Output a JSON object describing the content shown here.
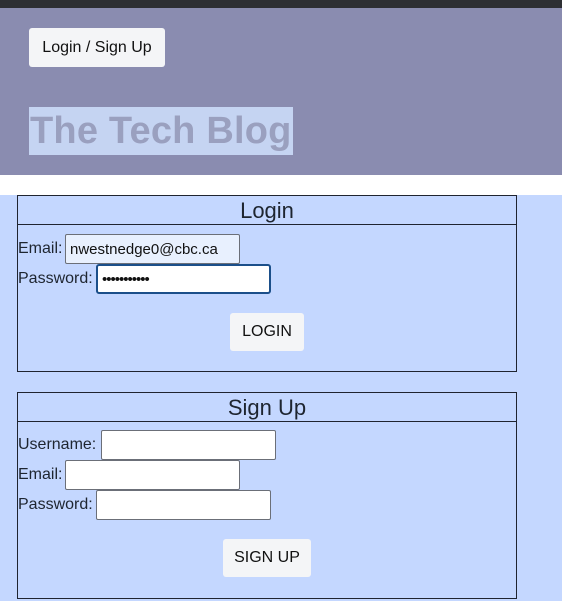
{
  "header": {
    "nav_button_label": "Login / Sign Up",
    "site_title": "The Tech Blog"
  },
  "login": {
    "title": "Login",
    "email_label": "Email:",
    "email_value": "nwestnedge0@cbc.ca",
    "password_label": "Password:",
    "password_value": "•••••••••••",
    "submit_label": "LOGIN"
  },
  "signup": {
    "title": "Sign Up",
    "username_label": "Username:",
    "username_value": "",
    "email_label": "Email:",
    "email_value": "",
    "password_label": "Password:",
    "password_value": "",
    "submit_label": "SIGN UP"
  },
  "colors": {
    "header_bg": "#8a8cb0",
    "page_bg": "#c4d7ff",
    "title_highlight": "#c5d4f2",
    "title_text": "#9aa0bf",
    "focus_border": "#1b4f8a"
  }
}
